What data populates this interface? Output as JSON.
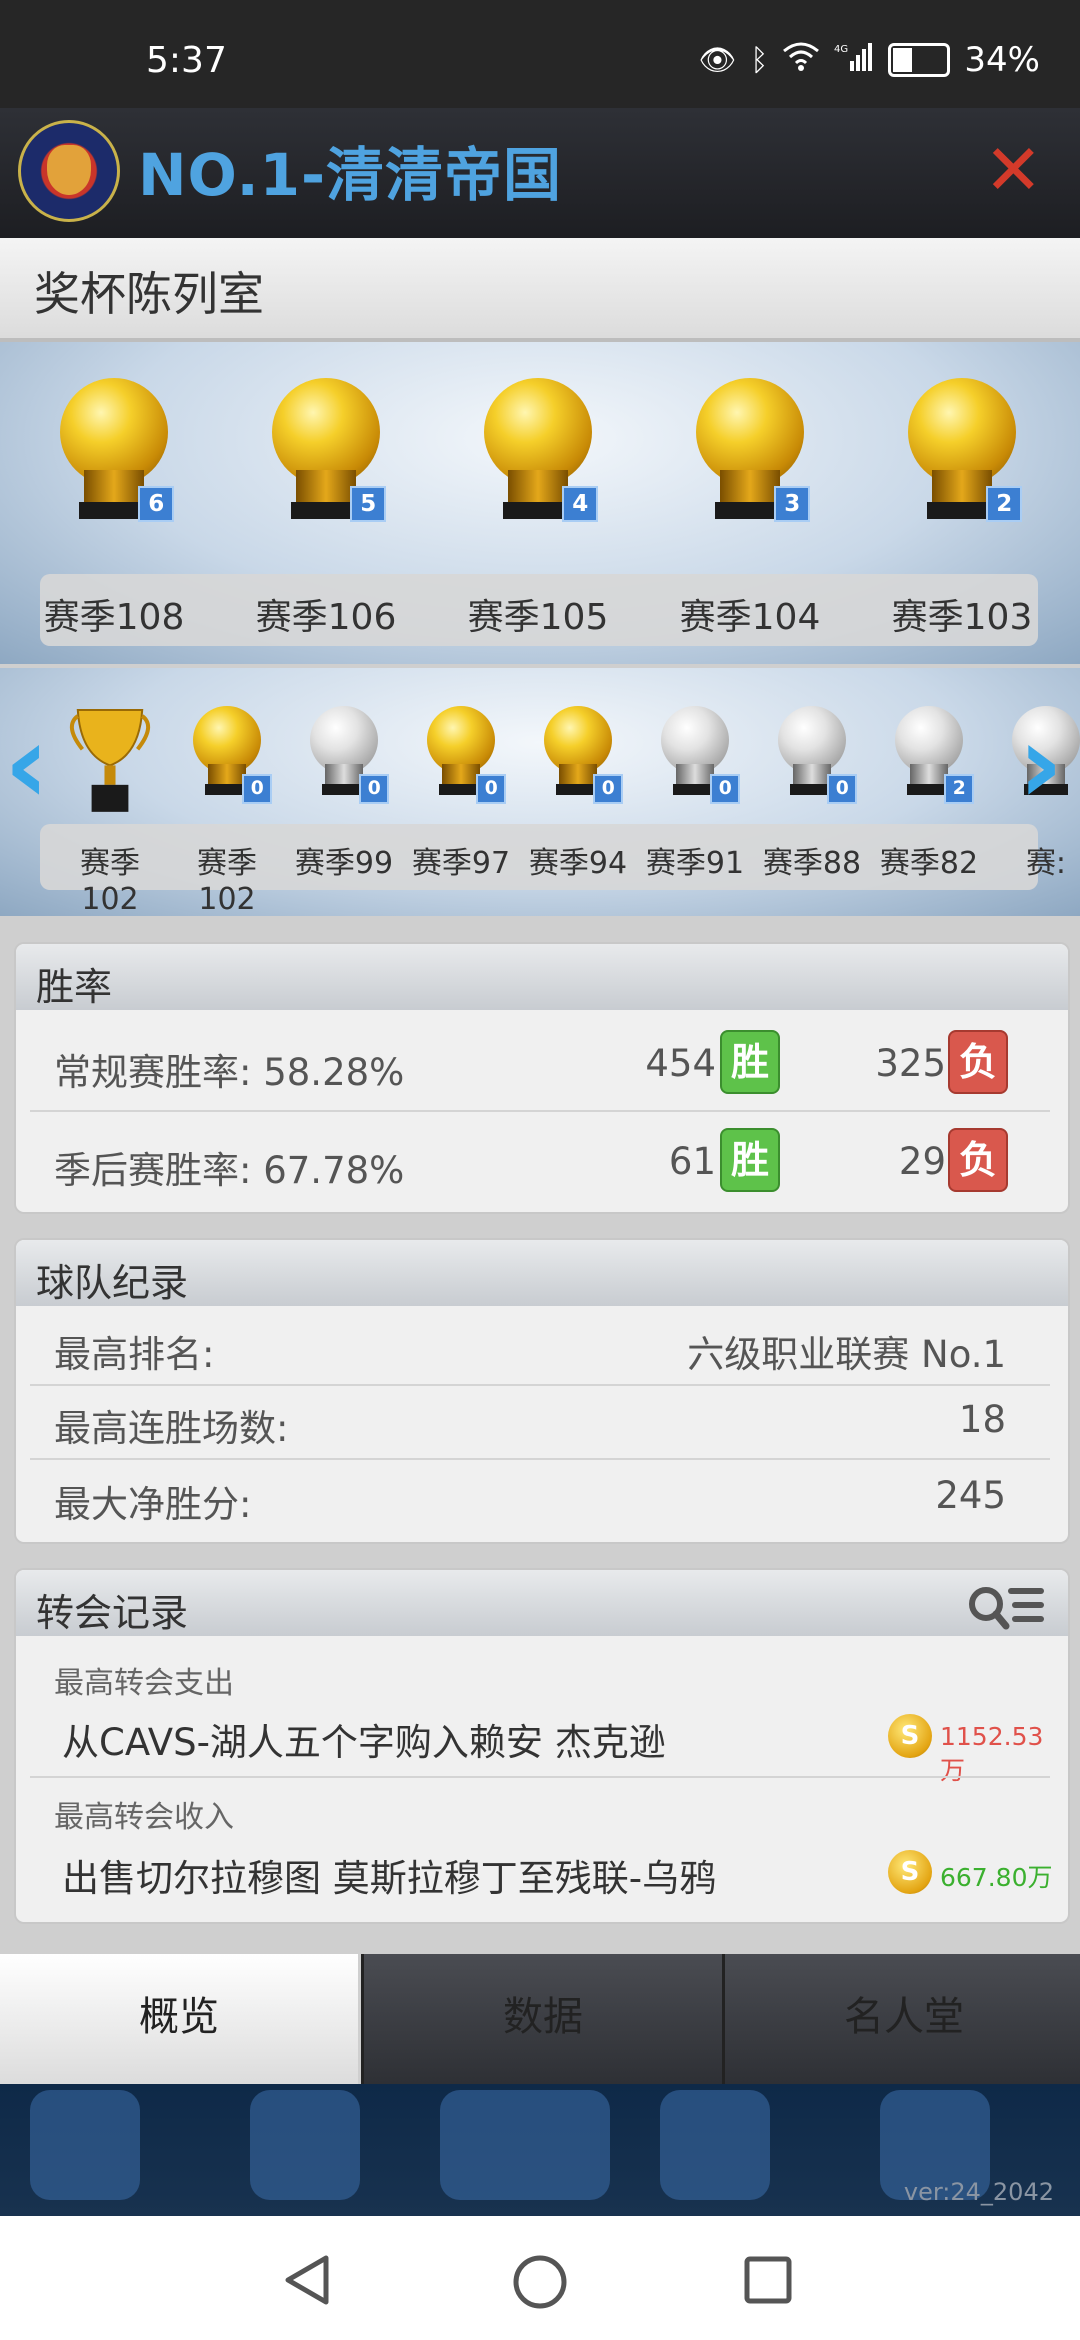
{
  "status_bar": {
    "time": "5:37",
    "battery": "34%",
    "network": "4G"
  },
  "header": {
    "team_name": "NO.1-清清帝国",
    "close_icon": "close-icon"
  },
  "trophy_room": {
    "title": "奖杯陈列室",
    "top_row": [
      {
        "season": "赛季108",
        "count": "6",
        "kind": "gold"
      },
      {
        "season": "赛季106",
        "count": "5",
        "kind": "gold"
      },
      {
        "season": "赛季105",
        "count": "4",
        "kind": "gold"
      },
      {
        "season": "赛季104",
        "count": "3",
        "kind": "gold"
      },
      {
        "season": "赛季103",
        "count": "2",
        "kind": "gold"
      }
    ],
    "bottom_row": [
      {
        "season": "赛季102",
        "count": "",
        "kind": "cup"
      },
      {
        "season": "赛季102",
        "count": "0",
        "kind": "gold"
      },
      {
        "season": "赛季99",
        "count": "0",
        "kind": "silver"
      },
      {
        "season": "赛季97",
        "count": "0",
        "kind": "gold"
      },
      {
        "season": "赛季94",
        "count": "0",
        "kind": "gold"
      },
      {
        "season": "赛季91",
        "count": "0",
        "kind": "silver"
      },
      {
        "season": "赛季88",
        "count": "0",
        "kind": "silver"
      },
      {
        "season": "赛季82",
        "count": "2",
        "kind": "silver"
      },
      {
        "season": "赛:",
        "count": "",
        "kind": "silver"
      }
    ]
  },
  "win_rate": {
    "title": "胜率",
    "win_label": "胜",
    "loss_label": "负",
    "regular": {
      "label": "常规赛胜率:  58.28%",
      "wins": "454",
      "losses": "325"
    },
    "playoff": {
      "label": "季后赛胜率:  67.78%",
      "wins": "61",
      "losses": "29"
    }
  },
  "team_record": {
    "title": "球队纪录",
    "best_rank": {
      "label": "最高排名:",
      "value": "六级职业联赛 No.1"
    },
    "longest_streak": {
      "label": "最高连胜场数:",
      "value": "18"
    },
    "max_margin": {
      "label": "最大净胜分:",
      "value": "245"
    }
  },
  "transfer_record": {
    "title": "转会记录",
    "top_spend": {
      "label": "最高转会支出",
      "detail": "从CAVS-湖人五个字购入赖安 杰克逊",
      "amount": "1152.53万",
      "amount_color": "#e0514a"
    },
    "top_income": {
      "label": "最高转会收入",
      "detail": "出售切尔拉穆图 莫斯拉穆丁至残联-乌鸦",
      "amount": "667.80万",
      "amount_color": "#3bb02f"
    },
    "coin_glyph": "S"
  },
  "tabs": {
    "overview": "概览",
    "data": "数据",
    "hall_of_fame": "名人堂"
  },
  "version": "ver:24_2042"
}
